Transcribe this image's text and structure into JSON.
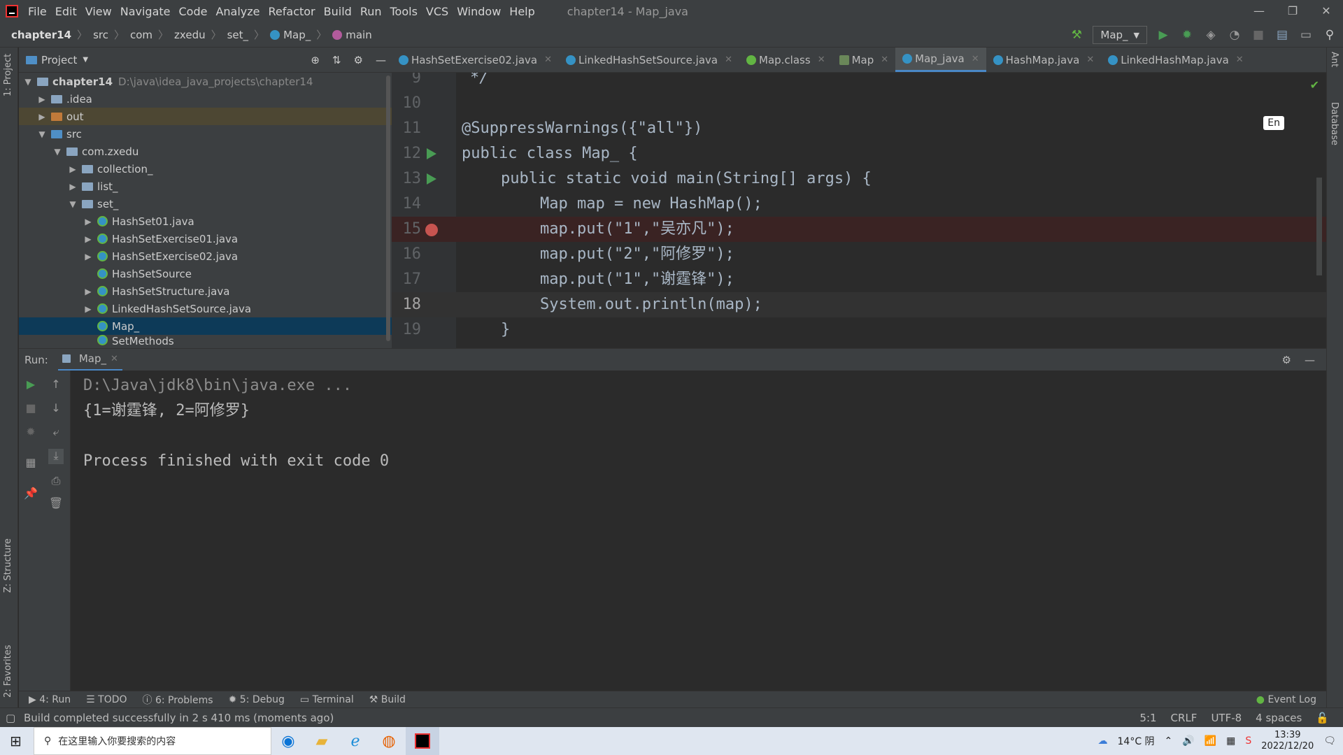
{
  "menubar": {
    "items": [
      "File",
      "Edit",
      "View",
      "Navigate",
      "Code",
      "Analyze",
      "Refactor",
      "Build",
      "Run",
      "Tools",
      "VCS",
      "Window",
      "Help"
    ],
    "title": "chapter14 - Map_java"
  },
  "navbar": {
    "crumbs": [
      "chapter14",
      "src",
      "com",
      "zxedu",
      "set_",
      "Map_",
      "main"
    ],
    "run_config": "Map_"
  },
  "project": {
    "label": "Project",
    "root": {
      "name": "chapter14",
      "path": "D:\\java\\idea_java_projects\\chapter14"
    },
    "items": [
      ".idea",
      "out",
      "src",
      "com.zxedu",
      "collection_",
      "list_",
      "set_",
      "HashSet01.java",
      "HashSetExercise01.java",
      "HashSetExercise02.java",
      "HashSetSource",
      "HashSetStructure.java",
      "LinkedHashSetSource.java",
      "Map_",
      "SetMethods"
    ]
  },
  "tabs": [
    "HashSetExercise02.java",
    "LinkedHashSetSource.java",
    "Map.class",
    "Map",
    "Map_java",
    "HashMap.java",
    "LinkedHashMap.java"
  ],
  "editor": {
    "lines": [
      {
        "n": "9",
        "t": "*/"
      },
      {
        "n": "10",
        "t": ""
      },
      {
        "n": "11",
        "t": "@SuppressWarnings({\"all\"})"
      },
      {
        "n": "12",
        "t": "public class Map_ {"
      },
      {
        "n": "13",
        "t": "public static void main(String[] args) {"
      },
      {
        "n": "14",
        "t": "Map map = new HashMap();"
      },
      {
        "n": "15",
        "t": "map.put(\"1\",\"吴亦凡\");"
      },
      {
        "n": "16",
        "t": "map.put(\"2\",\"阿修罗\");"
      },
      {
        "n": "17",
        "t": "map.put(\"1\",\"谢霆锋\");"
      },
      {
        "n": "18",
        "t": "System.out.println(map);"
      },
      {
        "n": "19",
        "t": "}"
      }
    ],
    "input_badge": "En"
  },
  "run": {
    "label": "Run:",
    "tab": "Map_",
    "output": [
      "D:\\Java\\jdk8\\bin\\java.exe ...",
      "{1=谢霆锋, 2=阿修罗}",
      "",
      "Process finished with exit code 0"
    ]
  },
  "bottom_tabs": [
    "4: Run",
    "TODO",
    "6: Problems",
    "5: Debug",
    "Terminal",
    "Build"
  ],
  "event_log": "Event Log",
  "left_strip": [
    "1: Project",
    "Z: Structure",
    "2: Favorites"
  ],
  "right_strip": [
    "Ant",
    "Database"
  ],
  "status": {
    "message": "Build completed successfully in 2 s 410 ms (moments ago)",
    "position": "5:1",
    "line_sep": "CRLF",
    "encoding": "UTF-8",
    "indent": "4 spaces"
  },
  "taskbar": {
    "search_placeholder": "在这里输入你要搜索的内容",
    "weather": "14°C 阴",
    "time": "13:39",
    "date": "2022/12/20"
  }
}
